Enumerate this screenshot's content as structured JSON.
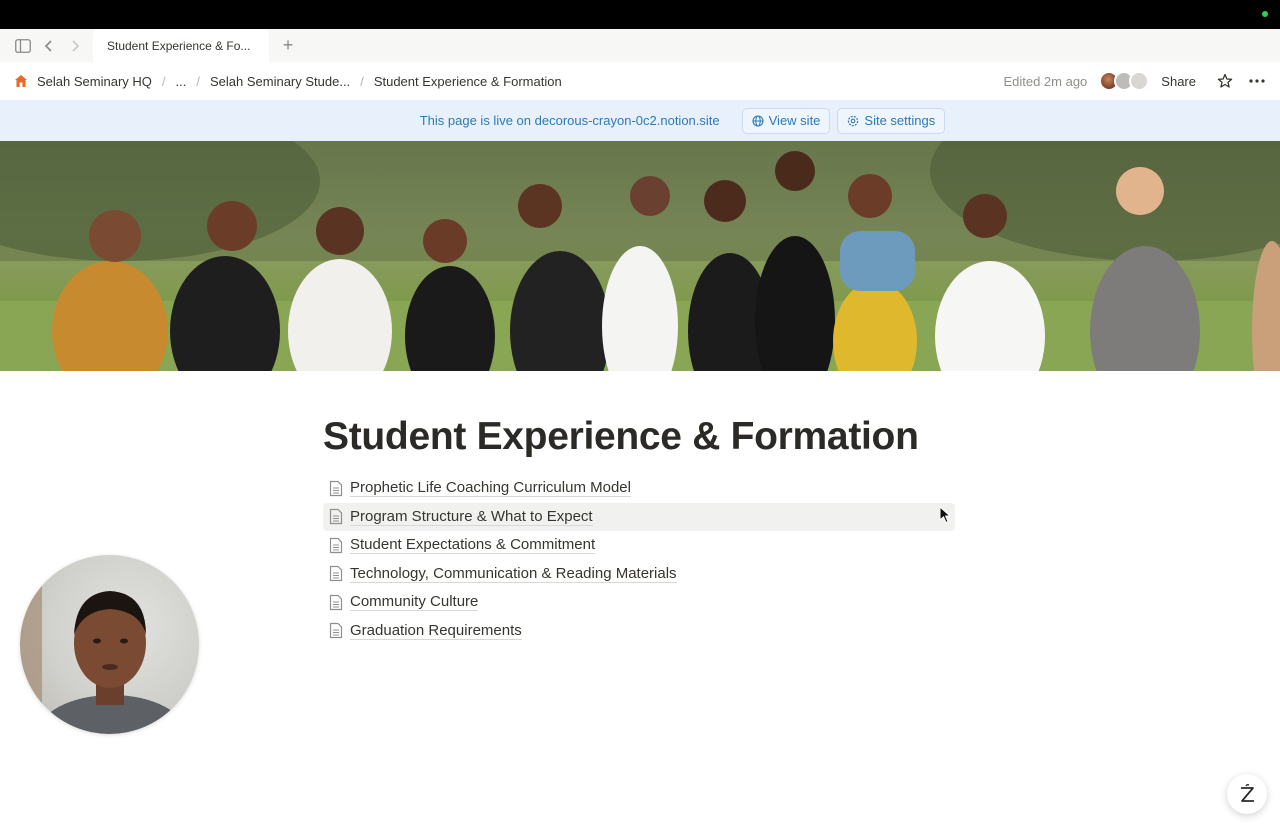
{
  "browser": {
    "tab_title": "Student Experience & Fo...",
    "new_tab_symbol": "+"
  },
  "breadcrumb": {
    "workspace": "Selah Seminary HQ",
    "ellipsis": "...",
    "parent": "Selah Seminary Stude...",
    "current": "Student Experience & Formation",
    "separator": "/"
  },
  "header": {
    "edited": "Edited 2m ago",
    "share_label": "Share"
  },
  "banner": {
    "message": "This page is live on decorous-crayon-0c2.notion.site",
    "view_site_label": "View site",
    "site_settings_label": "Site settings"
  },
  "page": {
    "title": "Student Experience & Formation",
    "subpages": [
      "Prophetic Life Coaching Curriculum Model",
      "Program Structure & What to Expect",
      "Student Expectations & Commitment",
      "Technology, Communication & Reading Materials",
      "Community Culture",
      "Graduation Requirements"
    ]
  },
  "colors": {
    "banner_bg": "#e8f1fb",
    "banner_text": "#2a7ab8",
    "workspace_icon": "#e8692a",
    "status_dot": "#2bd152"
  },
  "icons": [
    "sidebar-toggle-icon",
    "back-icon",
    "forward-icon",
    "workspace-icon",
    "star-icon",
    "more-icon",
    "globe-icon",
    "settings-icon",
    "page-doc-icon",
    "help-icon",
    "mouse-cursor-icon"
  ]
}
